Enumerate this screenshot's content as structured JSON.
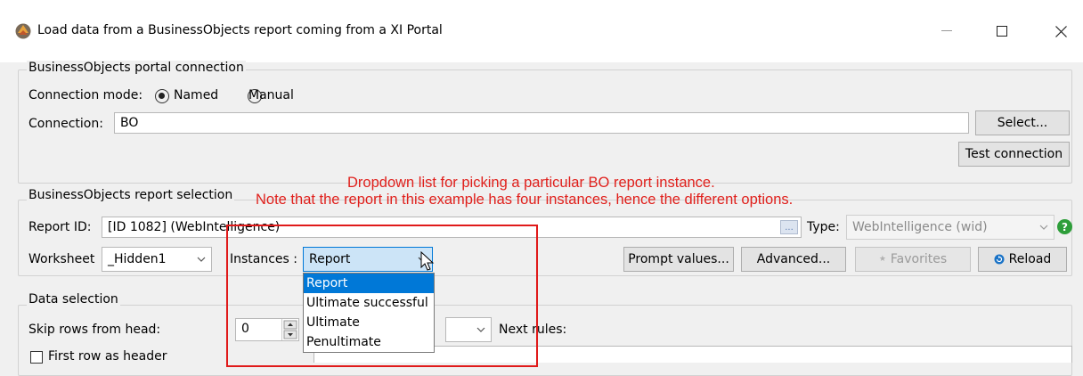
{
  "window": {
    "title": "Load data from a BusinessObjects report coming from a XI Portal"
  },
  "portal": {
    "group_label": "BusinessObjects portal connection",
    "connection_mode_label": "Connection mode:",
    "named_label": "Named",
    "manual_label": "Manual",
    "selected_mode": "Named",
    "connection_label": "Connection:",
    "connection_value": "BO",
    "select_button": "Select...",
    "test_button": "Test connection"
  },
  "annotation": {
    "line1": "Dropdown list for picking a particular BO report instance.",
    "line2": "Note that the report in this example has four instances, hence the different options.",
    "color": "#e0201c"
  },
  "report": {
    "group_label": "BusinessObjects report selection",
    "report_id_label": "Report ID:",
    "report_id_value": "[ID 1082]  (WebIntelligence)",
    "browse_button": "...",
    "type_label": "Type:",
    "type_value": "WebIntelligence (wid)",
    "help_icon": "?",
    "worksheet_label": "Worksheet",
    "worksheet_value": "_Hidden1",
    "instances_label": "Instances :",
    "instances_value": "Report",
    "instances_options": [
      "Report",
      "Ultimate successful",
      "Ultimate",
      "Penultimate"
    ],
    "prompt_button": "Prompt values...",
    "advanced_button": "Advanced...",
    "favorites_button": "Favorites",
    "reload_button": "Reload"
  },
  "data_selection": {
    "group_label": "Data selection",
    "skip_rows_label": "Skip rows from head:",
    "skip_rows_value": "0",
    "next_rules_label": "Next rules:",
    "first_row_label": "First row as header"
  },
  "colors": {
    "accent": "#0078d7",
    "help_green": "#2e9e3a",
    "reload_blue": "#1a73c7"
  }
}
